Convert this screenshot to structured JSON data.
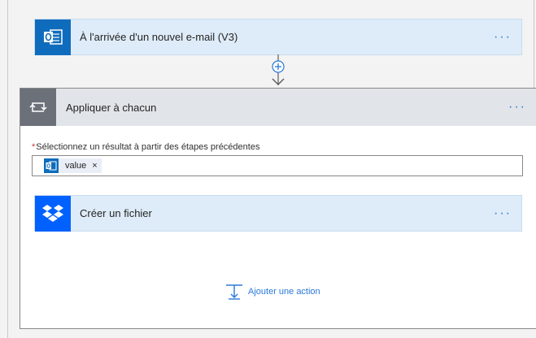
{
  "trigger": {
    "title": "À l'arrivée d'un nouvel e-mail (V3)",
    "icon": "outlook-icon",
    "more_label": "···",
    "accent": "#0f6cbd"
  },
  "connector": {
    "icon": "add-step-icon"
  },
  "loop": {
    "title": "Appliquer à chacun",
    "icon": "loop-icon",
    "more_label": "···",
    "field": {
      "required_mark": "*",
      "label": "Sélectionnez un résultat à partir des étapes précédentes",
      "token": {
        "label": "value",
        "remove_label": "×",
        "icon": "outlook-icon"
      }
    },
    "action": {
      "title": "Créer un fichier",
      "icon": "dropbox-icon",
      "more_label": "···",
      "accent": "#0061fe"
    },
    "add_action": {
      "label": "Ajouter une action",
      "icon": "add-action-icon"
    }
  }
}
